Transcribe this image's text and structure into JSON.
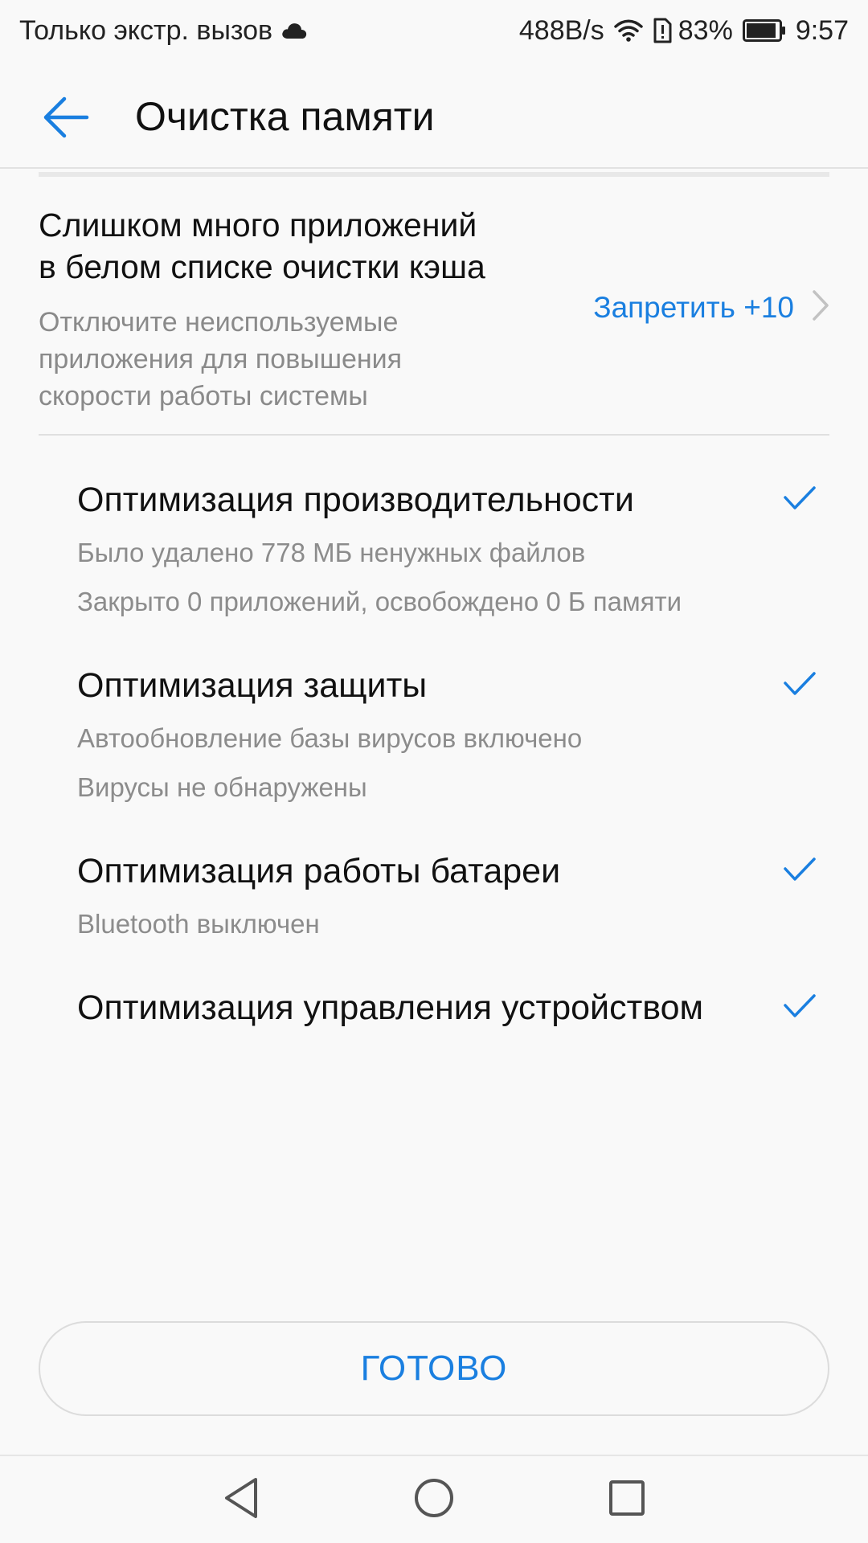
{
  "status_bar": {
    "carrier_text": "Только экстр. вызов",
    "net_speed": "488B/s",
    "battery_percent": "83%",
    "time": "9:57",
    "icons": [
      "cloud-icon",
      "wifi-icon",
      "sim-alert-icon",
      "battery-icon"
    ]
  },
  "header": {
    "back_icon": "arrow-left-icon",
    "title": "Очистка памяти"
  },
  "warning": {
    "title_line1": "Слишком много приложений",
    "title_line2": "в белом списке очистки кэша",
    "desc_line1": "Отключите неиспользуемые",
    "desc_line2": "приложения для повышения",
    "desc_line3": "скорости работы системы",
    "action_label": "Запретить +10",
    "action_icon": "chevron-right-icon"
  },
  "optimizations": [
    {
      "title": "Оптимизация производительности",
      "details": [
        "Было удалено 778 МБ ненужных файлов",
        "Закрыто 0 приложений, освобождено 0 Б памяти"
      ],
      "done": true
    },
    {
      "title": "Оптимизация защиты",
      "details": [
        "Автообновление базы вирусов включено",
        "Вирусы не обнаружены"
      ],
      "done": true
    },
    {
      "title": "Оптимизация работы батареи",
      "details": [
        "Bluetooth выключен"
      ],
      "done": true
    },
    {
      "title": "Оптимизация управления устройством",
      "details": [],
      "done": true
    }
  ],
  "done_button": {
    "label": "ГОТОВО"
  },
  "nav_bar": {
    "icons": [
      "back-triangle-icon",
      "home-circle-icon",
      "recents-square-icon"
    ]
  },
  "colors": {
    "accent": "#1a7fe0",
    "background": "#f9f9f9",
    "secondary_text": "#8c8c8c"
  }
}
